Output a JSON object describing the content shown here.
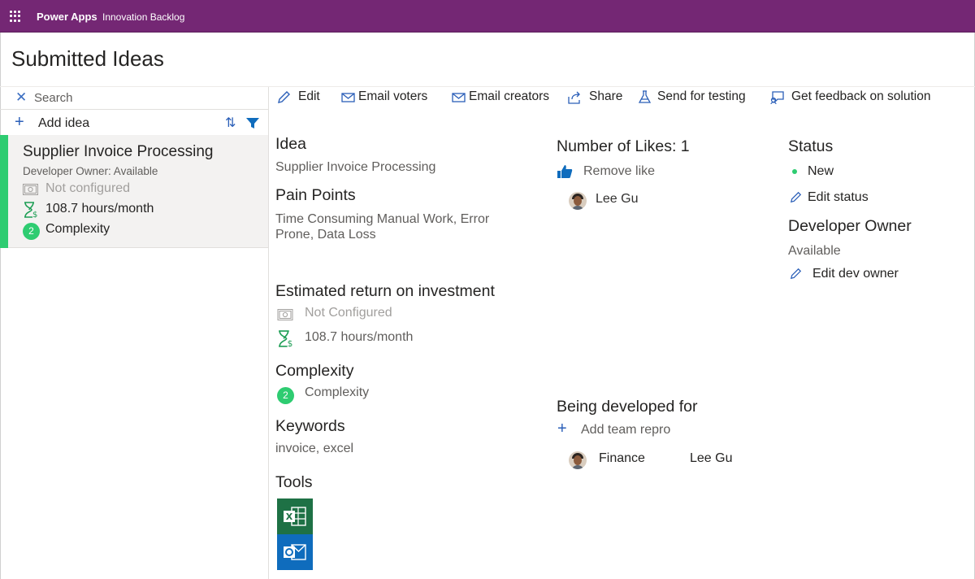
{
  "topbar": {
    "app_name": "Power Apps",
    "app_subtitle": "Innovation Backlog",
    "color": "#742774"
  },
  "page": {
    "title": "Submitted Ideas"
  },
  "left_panel": {
    "search_placeholder": "Search",
    "add_idea_label": "Add idea",
    "ideas": [
      {
        "title": "Supplier Invoice Processing",
        "developer_owner": "Developer Owner: Available",
        "roi_money": "Not configured",
        "roi_time": "108.7 hours/month",
        "complexity_level": "2",
        "complexity_label": "Complexity",
        "accent_color": "#2ecc71"
      }
    ]
  },
  "command_bar": {
    "edit": "Edit",
    "email_voters": "Email voters",
    "email_creators": "Email creators",
    "share": "Share",
    "send_for_testing": "Send for testing",
    "get_feedback": "Get feedback on solution"
  },
  "detail": {
    "idea_heading": "Idea",
    "idea_value": "Supplier Invoice Processing",
    "pain_points_heading": "Pain Points",
    "pain_points_line1": "Time Consuming Manual Work, Error",
    "pain_points_line2": "Prone, Data Loss",
    "roi_heading": "Estimated return on investment",
    "roi_money": "Not Configured",
    "roi_time": "108.7 hours/month",
    "complexity_heading": "Complexity",
    "complexity_level": "2",
    "complexity_label": "Complexity",
    "keywords_heading": "Keywords",
    "keywords_value": "invoice, excel",
    "tools_heading": "Tools",
    "tools": [
      "excel-icon",
      "outlook-icon"
    ],
    "likes_heading": "Number of Likes: 1",
    "remove_like": "Remove like",
    "liker_name": "Lee Gu",
    "being_developed_heading": "Being developed for",
    "add_team_label": "Add team repro",
    "team_name": "Finance",
    "team_member": "Lee Gu",
    "status_heading": "Status",
    "status_value": "New",
    "edit_status": "Edit status",
    "dev_owner_heading": "Developer Owner",
    "dev_owner_value": "Available",
    "edit_dev_owner": "Edit dev owner"
  },
  "colors": {
    "accent_blue": "#2b5fb8",
    "status_green": "#2ecc71",
    "excel_green": "#1e7145",
    "outlook_blue": "#0f6cbd"
  }
}
